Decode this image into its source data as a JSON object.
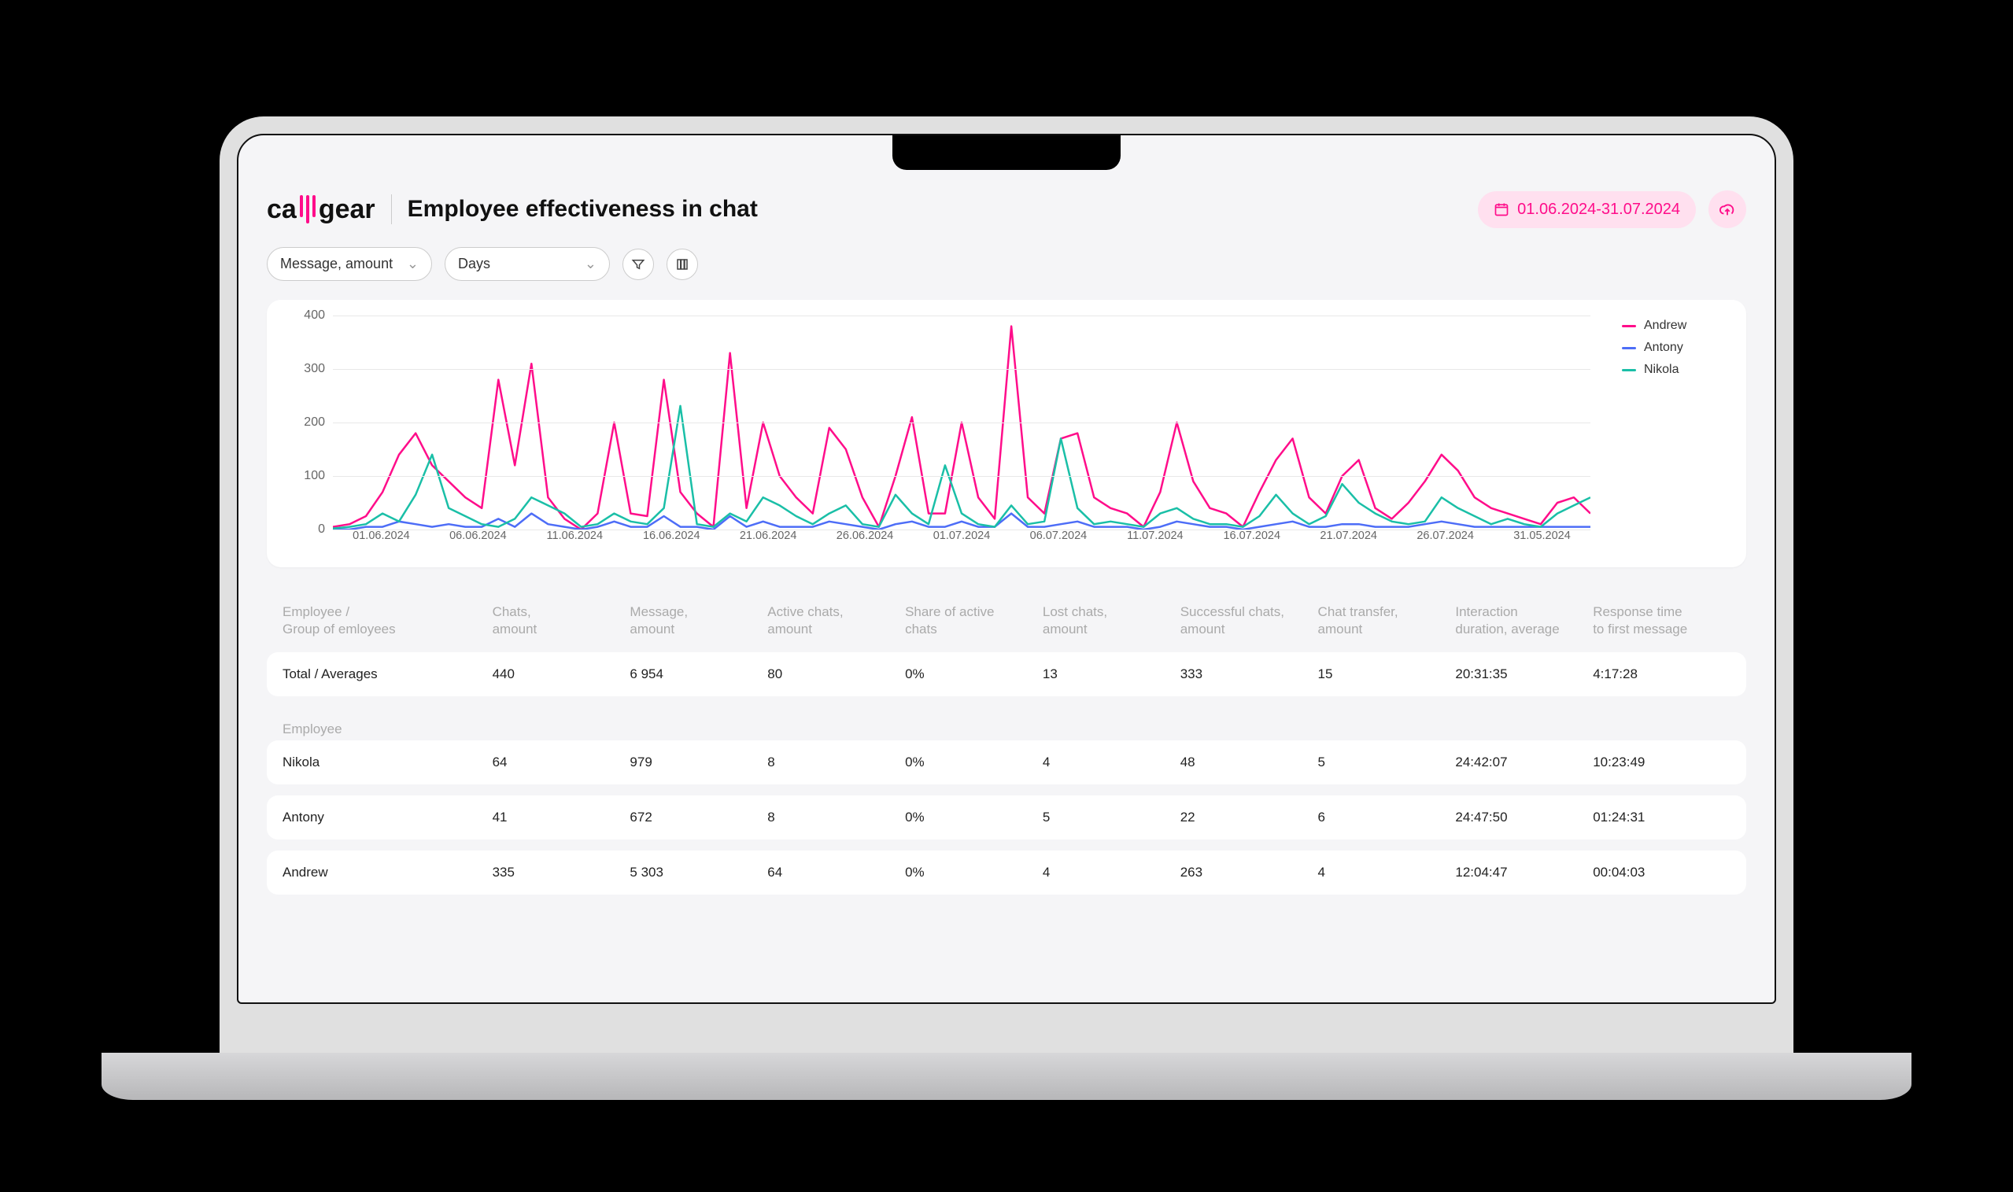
{
  "brand": {
    "left": "ca",
    "right": "gear"
  },
  "page_title": "Employee effectiveness in chat",
  "date_range": "01.06.2024-31.07.2024",
  "selects": {
    "metric": "Message, amount",
    "period": "Days"
  },
  "chart_data": {
    "type": "line",
    "xlabel": "",
    "ylabel": "",
    "ylim": [
      0,
      400
    ],
    "y_ticks": [
      0,
      100,
      200,
      300,
      400
    ],
    "x_ticks": [
      "01.06.2024",
      "06.06.2024",
      "11.06.2024",
      "16.06.2024",
      "21.06.2024",
      "26.06.2024",
      "01.07.2024",
      "06.07.2024",
      "11.07.2024",
      "16.07.2024",
      "21.07.2024",
      "26.07.2024",
      "31.05.2024"
    ],
    "series": [
      {
        "name": "Andrew",
        "color": "#ff0d8a",
        "values": [
          5,
          10,
          25,
          70,
          140,
          180,
          120,
          90,
          60,
          40,
          280,
          120,
          310,
          60,
          20,
          0,
          30,
          200,
          30,
          25,
          280,
          70,
          30,
          5,
          330,
          40,
          200,
          100,
          60,
          30,
          190,
          150,
          60,
          5,
          100,
          210,
          30,
          30,
          200,
          60,
          20,
          380,
          60,
          30,
          170,
          180,
          60,
          40,
          30,
          5,
          70,
          200,
          90,
          40,
          30,
          5,
          70,
          130,
          170,
          60,
          30,
          100,
          130,
          40,
          20,
          50,
          90,
          140,
          110,
          60,
          40,
          30,
          20,
          10,
          50,
          60,
          30
        ]
      },
      {
        "name": "Antony",
        "color": "#4d6df7",
        "values": [
          0,
          0,
          5,
          5,
          15,
          10,
          5,
          10,
          5,
          5,
          20,
          5,
          30,
          10,
          5,
          0,
          5,
          15,
          5,
          5,
          25,
          5,
          5,
          0,
          25,
          5,
          15,
          5,
          5,
          5,
          15,
          10,
          5,
          0,
          10,
          15,
          5,
          5,
          15,
          5,
          5,
          30,
          5,
          5,
          10,
          15,
          5,
          5,
          5,
          0,
          5,
          15,
          10,
          5,
          5,
          0,
          5,
          10,
          15,
          5,
          5,
          10,
          10,
          5,
          5,
          5,
          10,
          15,
          10,
          5,
          5,
          5,
          5,
          5,
          5,
          5,
          5
        ]
      },
      {
        "name": "Nikola",
        "color": "#1abfa7",
        "values": [
          2,
          5,
          10,
          30,
          15,
          65,
          140,
          40,
          25,
          10,
          5,
          20,
          60,
          45,
          30,
          5,
          10,
          30,
          15,
          10,
          40,
          231,
          10,
          5,
          30,
          15,
          60,
          45,
          25,
          10,
          30,
          45,
          10,
          5,
          65,
          30,
          10,
          120,
          30,
          10,
          5,
          45,
          10,
          15,
          170,
          40,
          10,
          15,
          10,
          5,
          30,
          40,
          20,
          10,
          10,
          5,
          25,
          65,
          30,
          10,
          25,
          85,
          50,
          30,
          15,
          10,
          15,
          60,
          40,
          25,
          10,
          20,
          10,
          5,
          30,
          45,
          60
        ]
      }
    ]
  },
  "table": {
    "headers": [
      [
        "Employee /",
        "Group of emloyees"
      ],
      [
        "Chats,",
        "amount"
      ],
      [
        "Message,",
        "amount"
      ],
      [
        "Active chats,",
        "amount"
      ],
      [
        "Share of active",
        "chats"
      ],
      [
        "Lost chats,",
        "amount"
      ],
      [
        "Successful chats,",
        "amount"
      ],
      [
        "Chat transfer,",
        "amount"
      ],
      [
        "Interaction",
        "duration, average"
      ],
      [
        "Response time",
        "to first message"
      ]
    ],
    "total_label": "Total / Averages",
    "total": [
      "440",
      "6 954",
      "80",
      "0%",
      "13",
      "333",
      "15",
      "20:31:35",
      "4:17:28"
    ],
    "section_label": "Employee",
    "rows": [
      {
        "name": "Nikola",
        "cells": [
          "64",
          "979",
          "8",
          "0%",
          "4",
          "48",
          "5",
          "24:42:07",
          "10:23:49"
        ]
      },
      {
        "name": "Antony",
        "cells": [
          "41",
          "672",
          "8",
          "0%",
          "5",
          "22",
          "6",
          "24:47:50",
          "01:24:31"
        ]
      },
      {
        "name": "Andrew",
        "cells": [
          "335",
          "5 303",
          "64",
          "0%",
          "4",
          "263",
          "4",
          "12:04:47",
          "00:04:03"
        ]
      }
    ]
  }
}
